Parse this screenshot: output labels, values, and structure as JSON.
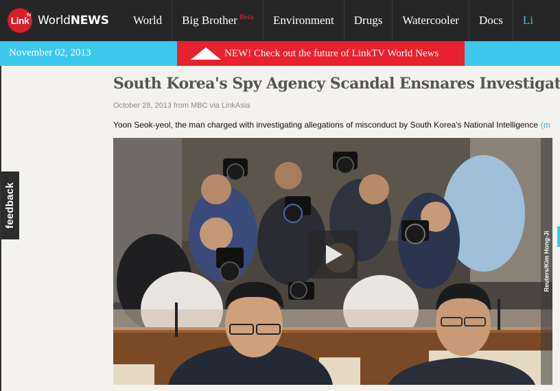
{
  "header": {
    "logo_mark": "Link",
    "logo_tv": "TV",
    "logo_world": "World",
    "logo_news": "NEWS",
    "nav": [
      {
        "label": "World"
      },
      {
        "label": "Big Brother",
        "badge": "Beta"
      },
      {
        "label": "Environment"
      },
      {
        "label": "Drugs"
      },
      {
        "label": "Watercooler"
      },
      {
        "label": "Docs"
      },
      {
        "label": "Li"
      }
    ]
  },
  "subbar": {
    "date": "November 02, 2013",
    "promo": "NEW! Check out the future of LinkTV World News"
  },
  "feedback_label": "feedback",
  "article": {
    "title": "South Korea's Spy Agency Scandal Ensnares Investigator",
    "meta": "October 28, 2013 from MBC via LinkAsia",
    "summary": "Yoon Seok-yeol, the man charged with investigating allegations of misconduct by South Korea's National Intelligence",
    "more": "(m",
    "photo_credit": "Reuters/Kim Hong-Ji"
  },
  "colors": {
    "header_bg": "#262626",
    "accent_cyan": "#3cc8ec",
    "accent_red": "#e8212e",
    "page_bg": "#f4f2ee"
  },
  "icons": {
    "promo": "triangle-up-icon",
    "video": "play-icon"
  }
}
